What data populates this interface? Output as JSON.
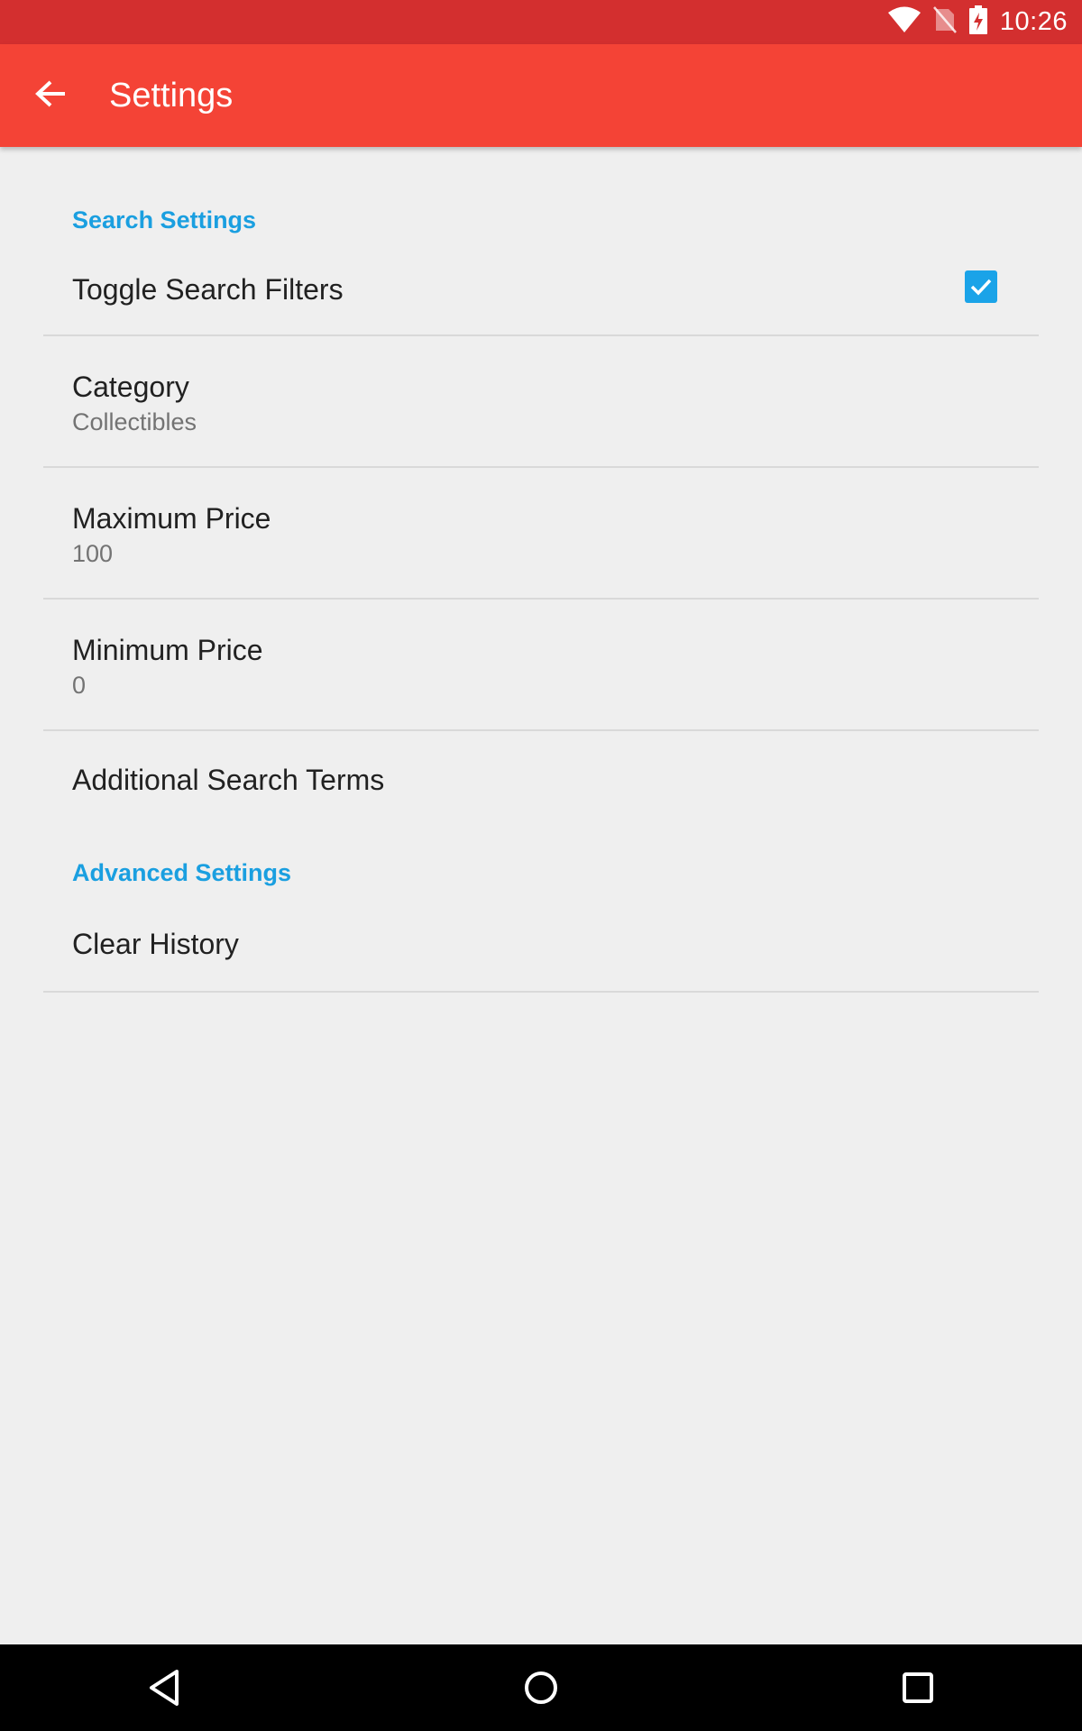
{
  "status_bar": {
    "time": "10:26",
    "icons": [
      "wifi-icon",
      "no-sim-icon",
      "battery-charging-icon"
    ]
  },
  "app_bar": {
    "back_icon": "arrow-back-icon",
    "title": "Settings",
    "color": "#f44336",
    "status_color": "#d32f2f"
  },
  "sections": [
    {
      "header": "Search Settings",
      "items": [
        {
          "title": "Toggle Search Filters",
          "checked": true
        },
        {
          "title": "Category",
          "summary": "Collectibles"
        },
        {
          "title": "Maximum Price",
          "summary": "100"
        },
        {
          "title": "Minimum Price",
          "summary": "0"
        },
        {
          "title": "Additional Search Terms"
        }
      ]
    },
    {
      "header": "Advanced Settings",
      "items": [
        {
          "title": "Clear History"
        }
      ]
    }
  ],
  "accent_color": "#1a9fe0",
  "nav_bar": {
    "buttons": [
      "back-triangle-icon",
      "home-circle-icon",
      "recents-square-icon"
    ]
  }
}
